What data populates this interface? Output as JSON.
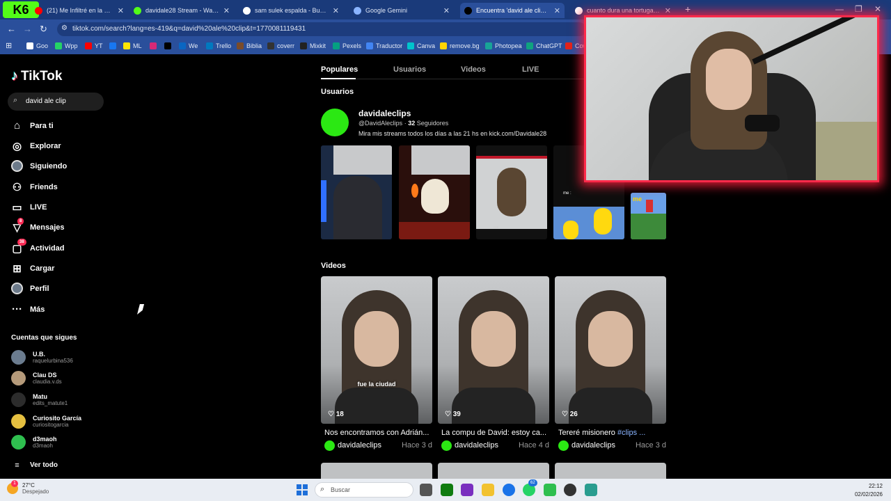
{
  "browser": {
    "kick_logo_text": "6",
    "tabs": [
      {
        "label": "(21) Me Infiltré en la Comunid",
        "color": "#ff0000",
        "active": false
      },
      {
        "label": "davidale28 Stream - Watch Live",
        "color": "#53fc18",
        "active": false
      },
      {
        "label": "sam sulek espalda - Buscar con",
        "color": "#ffffff",
        "active": false
      },
      {
        "label": "Google Gemini",
        "color": "#8ab4ff",
        "active": false
      },
      {
        "label": "Encuentra 'david ale clip' en Tik",
        "color": "#000000",
        "active": true
      },
      {
        "label": "cuanto dura una tortuga de agu",
        "color": "#ffffff",
        "active": false
      }
    ],
    "new_tab": "+",
    "url": "tiktok.com/search?lang=es-419&q=david%20ale%20clip&t=1770081119431",
    "bookmarks": [
      {
        "label": "Goo",
        "color": "#ffffff"
      },
      {
        "label": "Wpp",
        "color": "#25d366"
      },
      {
        "label": "YT",
        "color": "#ff0000"
      },
      {
        "label": "",
        "color": "#1877f2"
      },
      {
        "label": "ML",
        "color": "#ffe600"
      },
      {
        "label": "",
        "color": "#d62976"
      },
      {
        "label": "",
        "color": "#000000"
      },
      {
        "label": "We",
        "color": "#0a66c2"
      },
      {
        "label": "Trello",
        "color": "#0079bf"
      },
      {
        "label": "Biblia",
        "color": "#7a4b2a"
      },
      {
        "label": "coverr",
        "color": "#333333"
      },
      {
        "label": "Mixkit",
        "color": "#222222"
      },
      {
        "label": "Pexels",
        "color": "#05a081"
      },
      {
        "label": "Traductor",
        "color": "#4285f4"
      },
      {
        "label": "Canva",
        "color": "#00c4cc"
      },
      {
        "label": "remove.bg",
        "color": "#ffd400"
      },
      {
        "label": "Photopea",
        "color": "#18a497"
      },
      {
        "label": "ChatGPT",
        "color": "#10a37f"
      },
      {
        "label": "Cow",
        "color": "#e2231a"
      }
    ]
  },
  "tiktok": {
    "logo": "TikTok",
    "search_value": "david ale clip",
    "nav": [
      {
        "label": "Para ti",
        "icon": "home-icon",
        "glyph": "⌂"
      },
      {
        "label": "Explorar",
        "icon": "compass-icon",
        "glyph": "◎"
      },
      {
        "label": "Siguiendo",
        "icon": "following-avatar-icon",
        "glyph": "●"
      },
      {
        "label": "Friends",
        "icon": "friends-icon",
        "glyph": "⚇"
      },
      {
        "label": "LIVE",
        "icon": "live-icon",
        "glyph": "▭"
      },
      {
        "label": "Mensajes",
        "icon": "messages-icon",
        "glyph": "▽",
        "badge": "8"
      },
      {
        "label": "Actividad",
        "icon": "activity-icon",
        "glyph": "▢",
        "badge": "38"
      },
      {
        "label": "Cargar",
        "icon": "upload-icon",
        "glyph": "⊞"
      },
      {
        "label": "Perfil",
        "icon": "profile-icon",
        "glyph": "●"
      },
      {
        "label": "Más",
        "icon": "more-icon",
        "glyph": "···"
      }
    ],
    "following_title": "Cuentas que sigues",
    "following": [
      {
        "name": "U.B.",
        "handle": "raquelurbina536",
        "color": "#6b7c8f"
      },
      {
        "name": "Clau DS",
        "handle": "claudia.v.ds",
        "color": "#b59a7a"
      },
      {
        "name": "Matu",
        "handle": "edits_matute1",
        "color": "#2c2c2c"
      },
      {
        "name": "Curiosito García",
        "handle": "curiositogarcia",
        "color": "#e5c040"
      },
      {
        "name": "d3maoh",
        "handle": "d3maoh",
        "color": "#2fbf4f"
      }
    ],
    "see_all": "Ver todo",
    "tabs": [
      "Populares",
      "Usuarios",
      "Videos",
      "LIVE"
    ],
    "users_title": "Usuarios",
    "user": {
      "name": "davidaleclips",
      "handle": "@DavidAleclips",
      "separator": "·",
      "followers_count": "32",
      "followers_label": "Seguidores",
      "bio": "Mira mis streams todos los días a las 21 hs en kick.com/Davidale28"
    },
    "thumb_labels": {
      "t3": "ore",
      "t4_top": "me :",
      "t5": "me"
    },
    "videos_title": "Videos",
    "videos": [
      {
        "likes": "18",
        "caption_overlay": "fue la ciudad",
        "title": "Nos encontramos con Adrián...",
        "tag": "",
        "author": "davidaleclips",
        "age": "Hace 3 d"
      },
      {
        "likes": "39",
        "caption_overlay": "",
        "title": "La compu de David: estoy ca...",
        "tag": "",
        "author": "davidaleclips",
        "age": "Hace 4 d"
      },
      {
        "likes": "26",
        "caption_overlay": "",
        "title": "Tereré misionero ",
        "tag": "#clips ...",
        "author": "davidaleclips",
        "age": "Hace 3 d"
      }
    ]
  },
  "taskbar": {
    "temperature": "27°C",
    "condition": "Despejado",
    "weather_badge": "1",
    "search_placeholder": "Buscar",
    "time": "22:12",
    "date": "02/02/2026",
    "whatsapp_badge": "62"
  }
}
